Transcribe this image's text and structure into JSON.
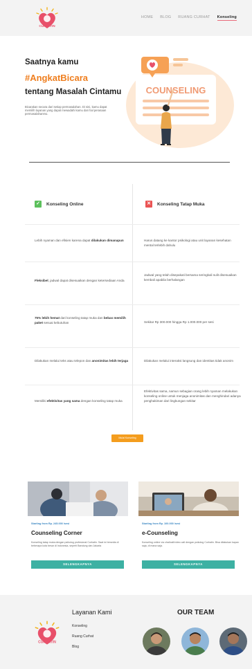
{
  "nav": {
    "logo_text": "CURHATIN",
    "links": [
      "HOME",
      "BLOG",
      "RUANG CURHAT",
      "Konseling"
    ]
  },
  "hero": {
    "line1": "Saatnya kamu",
    "line2": "#AngkatBicara",
    "line3": "tentang Masalah Cintamu",
    "description": "Bicarakan secara dari setiap permasalahan. Di sini, kamu dapat memilih layanan yang dapat mewadahi kamu dari hal perasaan permasalahanmu.",
    "art_label": "COUNSELING"
  },
  "comparison": {
    "online_title": "Konseling Online",
    "offline_title": "Konseling Tatap Muka",
    "rows": [
      {
        "online": [
          {
            "t": "Lebih nyaman dan efisien karena dapat "
          },
          {
            "t": "dilakukan dimanapun",
            "b": true
          }
        ],
        "offline": [
          {
            "t": "Harus datang ke kantor psikologi atau unit layanan kesehatan mental terlebih dahulu"
          }
        ]
      },
      {
        "online": [
          {
            "t": "Fleksibel",
            "b": true
          },
          {
            "t": ", jadwal dapat disesuaikan dengan ketersediaan Anda"
          }
        ],
        "offline": [
          {
            "t": "Jadwal yang telah disepakati bersama seringkali sulit disesuaikan kembali apabila berhalangan"
          }
        ]
      },
      {
        "online": [
          {
            "t": "75% lebih hemat",
            "b": true
          },
          {
            "t": " dari konseling tatap muka dan "
          },
          {
            "t": "bebas memilih paket",
            "b": true
          },
          {
            "t": " sesuai kebutuhan"
          }
        ],
        "offline": [
          {
            "t": "Sekitar Rp 300.000 hingga Rp 1.000.000 per sesi"
          }
        ]
      },
      {
        "online": [
          {
            "t": "Dilakukan melalui teks atau telepon dan "
          },
          {
            "t": "anonimitas lebih terjaga",
            "b": true
          }
        ],
        "offline": [
          {
            "t": "Dilakukan melalui interaksi langsung dan identitas tidak anonim"
          }
        ]
      },
      {
        "online": [
          {
            "t": "Memiliki "
          },
          {
            "t": "efektivitas yang sama",
            "b": true
          },
          {
            "t": " dengan konseling tatap muka"
          }
        ],
        "offline": [
          {
            "t": "Efektivitas sama, namun sebagian orang lebih nyaman melakukan konseling online untuk menjaga anonimitas dan menghindari adanya penghakiman dari lingkungan sekitar"
          }
        ]
      }
    ],
    "cta": "Mulai Konseling"
  },
  "cards": [
    {
      "price": "Starting from Rp. 245.000 /sesi",
      "title": "Counseling Corner",
      "desc": "Konseling tatap muka dengan psikolog profesional Curhatin. Saat ini tersedia di beberapa kota besar di Indonesia, seperti Bandung dan Jakarta",
      "button": "SELENGKAPNYA"
    },
    {
      "price": "Starting from Rp. 100.000 /sesi",
      "title": "e-Counseling",
      "desc": "Konseling online via chat/call/video call dengan psikolog Curhatin. Bisa dilakukan kapan saja, di mana saja.",
      "button": "SELENGKAPNYA"
    }
  ],
  "footer": {
    "logo_text": "CURHATIN",
    "services_title": "Layanan Kami",
    "links": [
      "Konseling",
      "Ruang Curhat",
      "Blog"
    ],
    "team_title": "OUR TEAM"
  },
  "colors": {
    "accent_orange": "#ef7e1e",
    "brand_pink": "#e8506a",
    "teal": "#3db1a3",
    "green_check": "#5cc05c",
    "red_x": "#ea5454"
  }
}
